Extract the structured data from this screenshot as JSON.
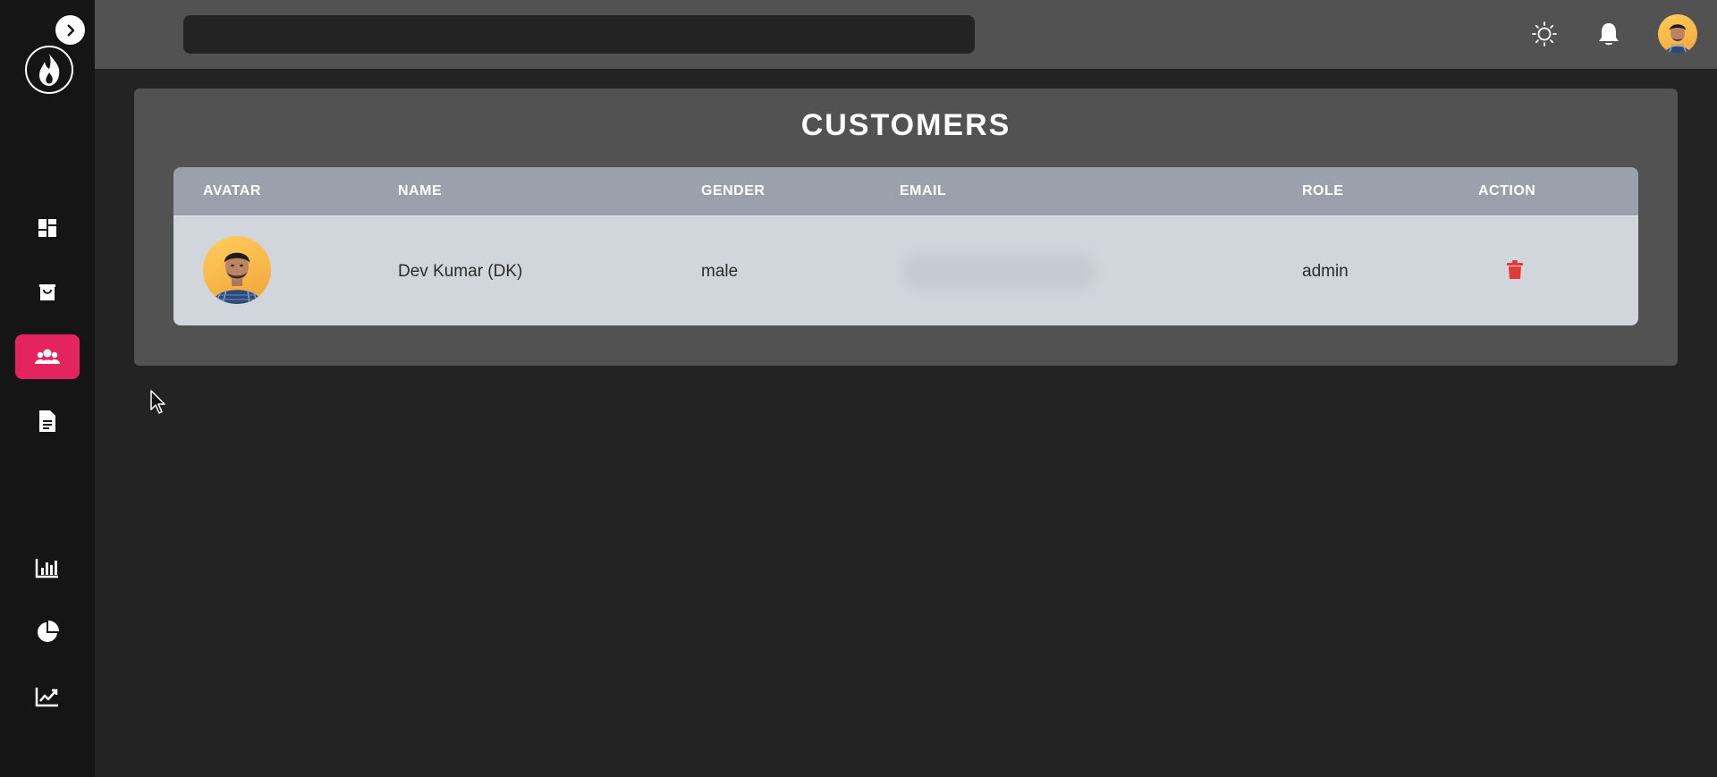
{
  "sidebar": {
    "toggle_icon": "chevron-right-icon",
    "logo_icon": "flame-logo-icon",
    "items": [
      {
        "name": "dashboard",
        "icon": "dashboard-icon",
        "active": false
      },
      {
        "name": "products",
        "icon": "shopping-bag-icon",
        "active": false
      },
      {
        "name": "customers",
        "icon": "users-icon",
        "active": true
      },
      {
        "name": "transactions",
        "icon": "document-icon",
        "active": false
      },
      {
        "name": "bar-chart",
        "icon": "bar-chart-icon",
        "active": false
      },
      {
        "name": "pie-chart",
        "icon": "pie-chart-icon",
        "active": false
      },
      {
        "name": "line-chart",
        "icon": "line-chart-icon",
        "active": false
      }
    ],
    "active_color": "#e3245f"
  },
  "topbar": {
    "search": {
      "value": "",
      "placeholder": ""
    },
    "icons": [
      "sun-icon",
      "bell-icon"
    ],
    "avatar": "user-avatar"
  },
  "main": {
    "title": "CUSTOMERS",
    "table": {
      "columns": [
        "AVATAR",
        "NAME",
        "GENDER",
        "EMAIL",
        "ROLE",
        "ACTION"
      ],
      "rows": [
        {
          "avatar": "user-avatar",
          "name": "Dev Kumar (DK)",
          "gender": "male",
          "email": "",
          "role": "admin",
          "action_icon": "trash-icon"
        }
      ]
    }
  },
  "colors": {
    "background": "#232323",
    "sidebar": "#151515",
    "topbar": "#525252",
    "header_row": "#9aa0ac",
    "body_row": "#d1d5dc",
    "delete": "#e5383b"
  }
}
